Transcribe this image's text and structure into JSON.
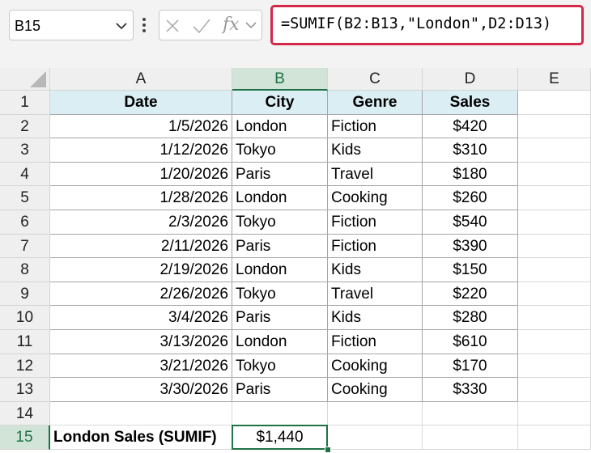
{
  "namebox": {
    "value": "B15"
  },
  "formula_bar": {
    "fx_label": "fx",
    "formula": "=SUMIF(B2:B13,\"London\",D2:D13)",
    "highlight_color": "#d4284a"
  },
  "columns": [
    "A",
    "B",
    "C",
    "D",
    "E"
  ],
  "rows": [
    "1",
    "2",
    "3",
    "4",
    "5",
    "6",
    "7",
    "8",
    "9",
    "10",
    "11",
    "12",
    "13",
    "14",
    "15"
  ],
  "selected": {
    "column": "B",
    "row": "15",
    "color": "#1e7145"
  },
  "table": {
    "header_fill": "#daeef3",
    "headers": [
      "Date",
      "City",
      "Genre",
      "Sales"
    ],
    "records": [
      [
        "1/5/2026",
        "London",
        "Fiction",
        "$420"
      ],
      [
        "1/12/2026",
        "Tokyo",
        "Kids",
        "$310"
      ],
      [
        "1/20/2026",
        "Paris",
        "Travel",
        "$180"
      ],
      [
        "1/28/2026",
        "London",
        "Cooking",
        "$260"
      ],
      [
        "2/3/2026",
        "Tokyo",
        "Fiction",
        "$540"
      ],
      [
        "2/11/2026",
        "Paris",
        "Fiction",
        "$390"
      ],
      [
        "2/19/2026",
        "London",
        "Kids",
        "$150"
      ],
      [
        "2/26/2026",
        "Tokyo",
        "Travel",
        "$220"
      ],
      [
        "3/4/2026",
        "Paris",
        "Kids",
        "$280"
      ],
      [
        "3/13/2026",
        "London",
        "Fiction",
        "$610"
      ],
      [
        "3/21/2026",
        "Tokyo",
        "Cooking",
        "$170"
      ],
      [
        "3/30/2026",
        "Paris",
        "Cooking",
        "$330"
      ]
    ]
  },
  "summary": {
    "label": "London Sales (SUMIF)",
    "value": "$1,440"
  }
}
